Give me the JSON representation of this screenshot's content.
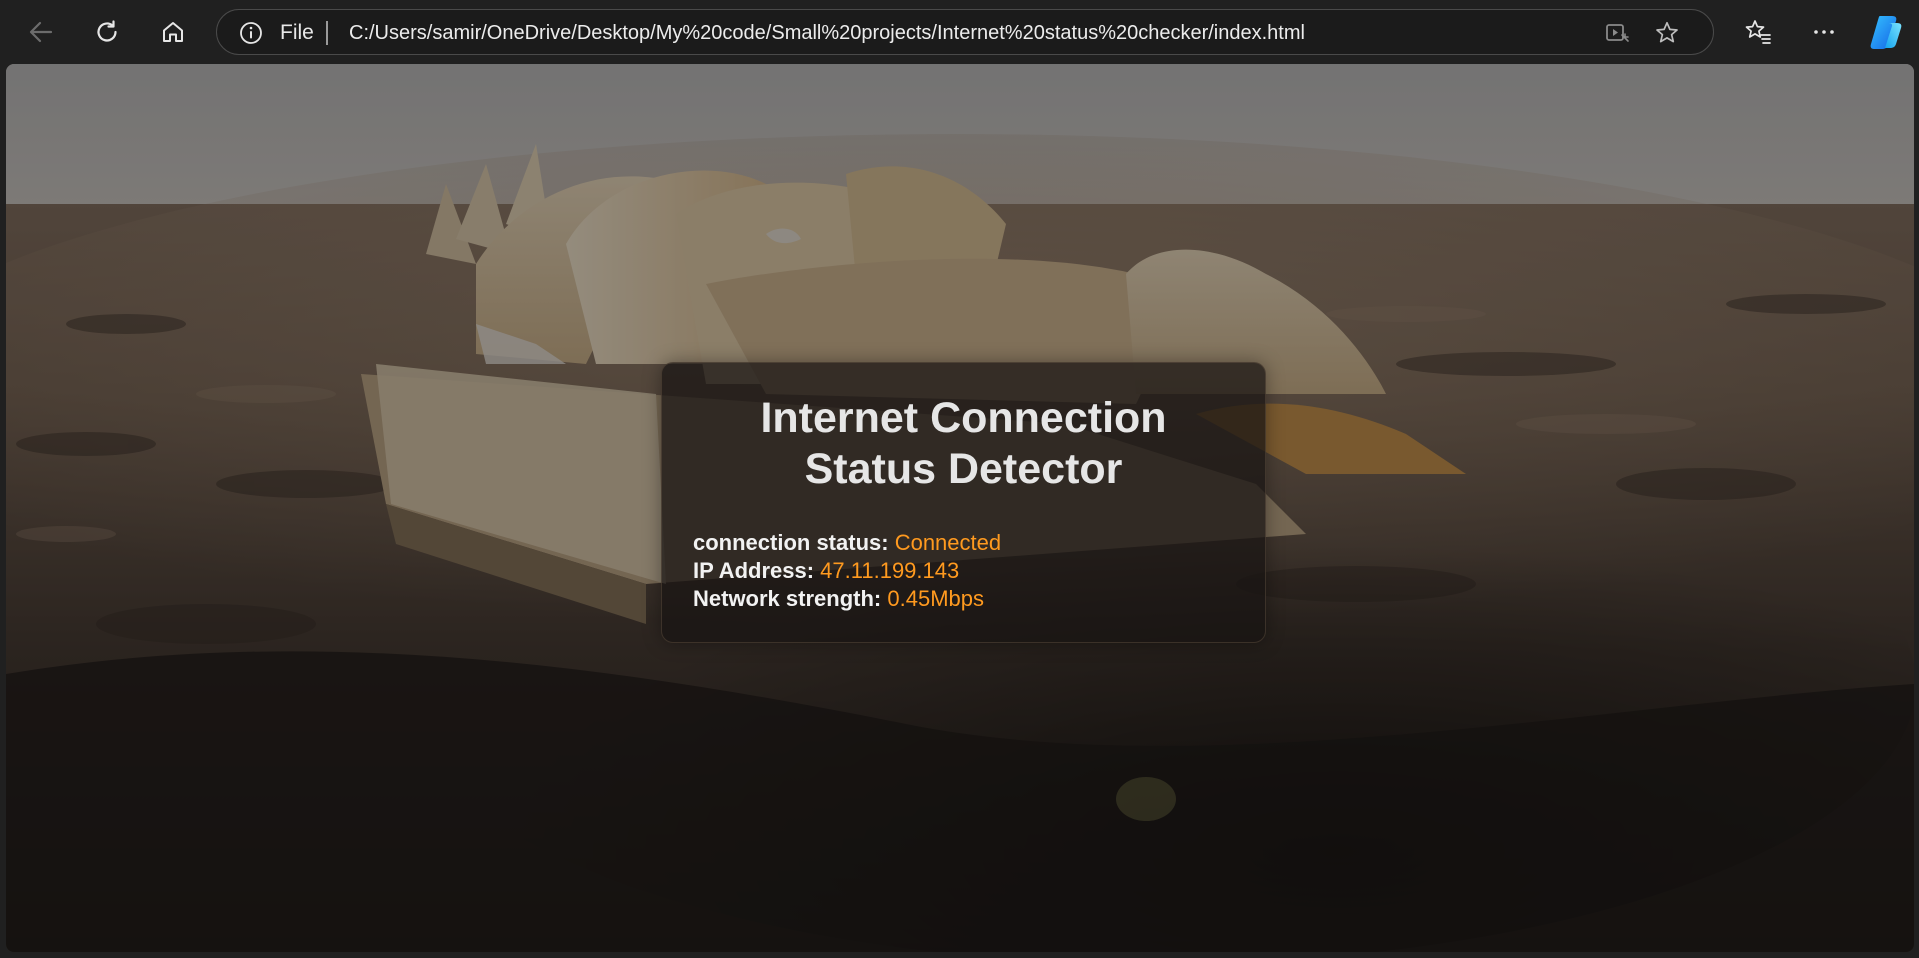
{
  "browser": {
    "scheme_label": "File",
    "url": "C:/Users/samir/OneDrive/Desktop/My%20code/Small%20projects/Internet%20status%20checker/index.html",
    "icons": {
      "back": "back-arrow-icon",
      "refresh": "refresh-icon",
      "home": "home-icon",
      "info": "info-icon",
      "immersive_reader": "immersive-reader-icon",
      "favorite": "star-icon",
      "favorites": "favorites-icon",
      "more": "more-icon",
      "copilot": "copilot-icon"
    }
  },
  "page": {
    "title_line1": "Internet Connection",
    "title_line2": "Status Detector",
    "rows": [
      {
        "label": "connection status:",
        "value": "Connected"
      },
      {
        "label": "IP Address:",
        "value": "47.11.199.143"
      },
      {
        "label": "Network strength:",
        "value": "0.45Mbps"
      }
    ]
  },
  "colors": {
    "accent": "#ff9a1f",
    "label_text": "#f2f2f2",
    "title_text": "#e6e6e6",
    "browser_bg": "#202020"
  }
}
